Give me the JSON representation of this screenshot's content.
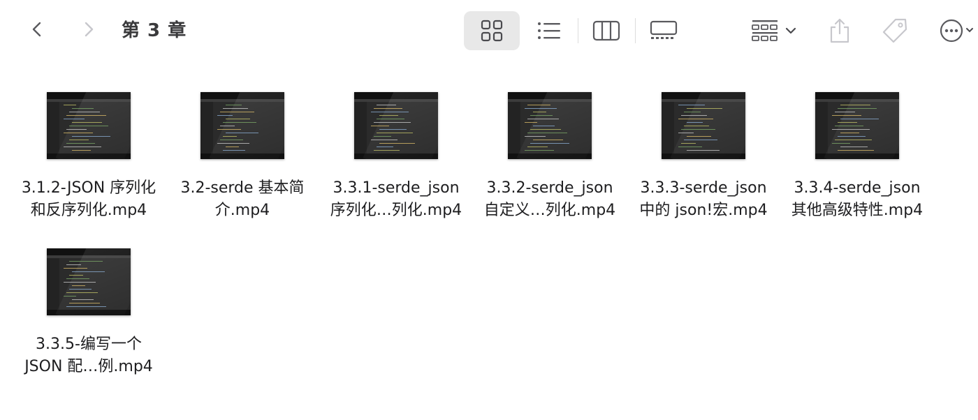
{
  "window": {
    "title": "第 3 章"
  },
  "toolbar": {
    "back_icon": "chevron-left-icon",
    "forward_icon": "chevron-right-icon",
    "view_icons": [
      "icon-view-icon",
      "list-view-icon",
      "column-view-icon",
      "gallery-view-icon"
    ],
    "active_view": "icon-view",
    "group_icon": "group-by-icon",
    "share_icon": "share-icon",
    "tag_icon": "tag-icon",
    "more_icon": "more-icon"
  },
  "files": [
    {
      "line1": "3.1.2-JSON 序列化",
      "line2": "和反序列化.mp4"
    },
    {
      "line1": "3.2-serde 基本简",
      "line2": "介.mp4"
    },
    {
      "line1": "3.3.1-serde_json",
      "line2": "序列化…列化.mp4"
    },
    {
      "line1": "3.3.2-serde_json",
      "line2": "自定义…列化.mp4"
    },
    {
      "line1": "3.3.3-serde_json",
      "line2": "中的 json!宏.mp4"
    },
    {
      "line1": "3.3.4-serde_json",
      "line2": "其他高级特性.mp4"
    },
    {
      "line1": "3.3.5-编写一个",
      "line2": "JSON 配…例.mp4"
    }
  ],
  "colors": {
    "accent_disabled": "#c7c7cc",
    "icon_active": "#5a5a5e",
    "selected_bg": "#e8e8e8"
  }
}
